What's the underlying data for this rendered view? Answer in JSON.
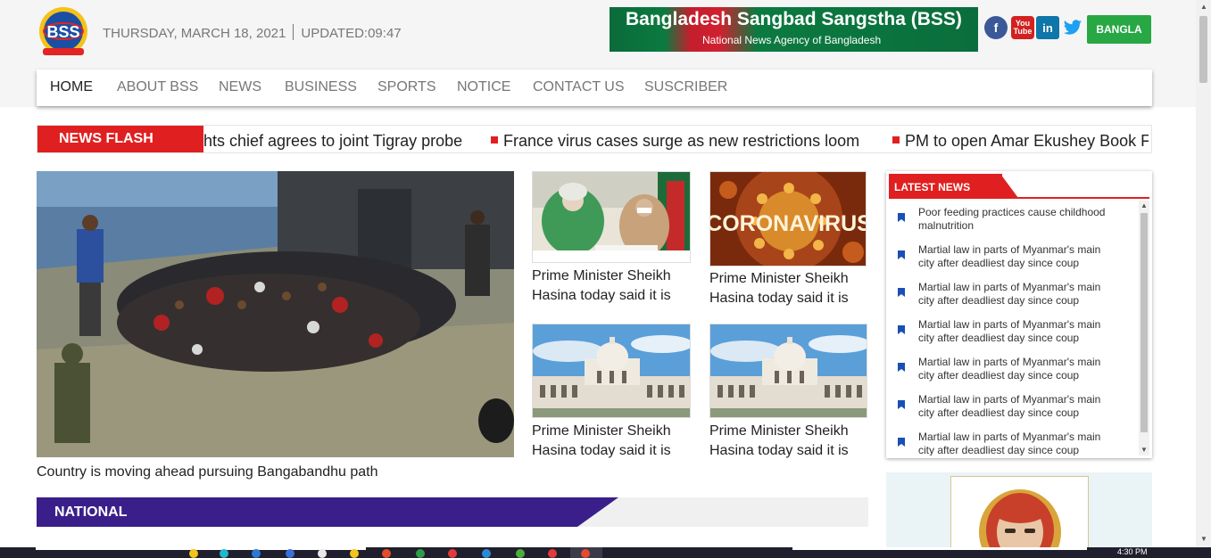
{
  "header": {
    "date": "THURSDAY, MARCH 18, 2021",
    "updated": "UPDATED:09:47",
    "banner_title": "Bangladesh Sangbad Sangstha (BSS)",
    "banner_subtitle": "National News Agency of Bangladesh",
    "logo_text": "BSS",
    "social": {
      "facebook_glyph": "f",
      "youtube_glyph": "You Tube",
      "linkedin_glyph": "in",
      "twitter_glyph": "🐦"
    },
    "language_button": "BANGLA"
  },
  "nav": {
    "items": [
      "HOME",
      "ABOUT BSS",
      "NEWS",
      "BUSINESS",
      "SPORTS",
      "NOTICE",
      "CONTACT US",
      "SUSCRIBER"
    ],
    "active": "HOME"
  },
  "news_flash": {
    "label": "NEWS FLASH",
    "items": [
      "ghts chief agrees to joint Tigray probe",
      "France virus cases surge as new restrictions loom",
      "PM to open Amar Ekushey Book Fa"
    ]
  },
  "lead_story": {
    "caption": "Country is moving ahead pursuing Bangabandhu path"
  },
  "thumbs": [
    {
      "caption": "Prime Minister Sheikh Hasina today said it is",
      "image": "pm-meeting"
    },
    {
      "caption": "Prime Minister Sheikh Hasina today said it is",
      "image": "coronavirus",
      "image_text": "CORONAVIRUS"
    },
    {
      "caption": "Prime Minister Sheikh Hasina today said it is",
      "image": "supreme-court"
    },
    {
      "caption": "Prime Minister Sheikh Hasina today said it is",
      "image": "supreme-court"
    }
  ],
  "latest_news": {
    "title": "LATEST NEWS",
    "items": [
      "Poor feeding practices cause childhood malnutrition",
      "Martial law in parts of Myanmar's main city after deadliest day since coup",
      "Martial law in parts of Myanmar's main city after deadliest day since coup",
      "Martial law in parts of Myanmar's main city after deadliest day since coup",
      "Martial law in parts of Myanmar's main city after deadliest day since coup",
      "Martial law in parts of Myanmar's main city after deadliest day since coup",
      "Martial law in parts of Myanmar's main city after deadliest day since coup"
    ]
  },
  "sections": {
    "national": "NATIONAL"
  },
  "taskbar": {
    "clock": "4:30 PM"
  },
  "colors": {
    "accent_red": "#e02020",
    "national_purple": "#3a1f8a",
    "bangla_green": "#28a745",
    "nav_text": "#777777"
  }
}
